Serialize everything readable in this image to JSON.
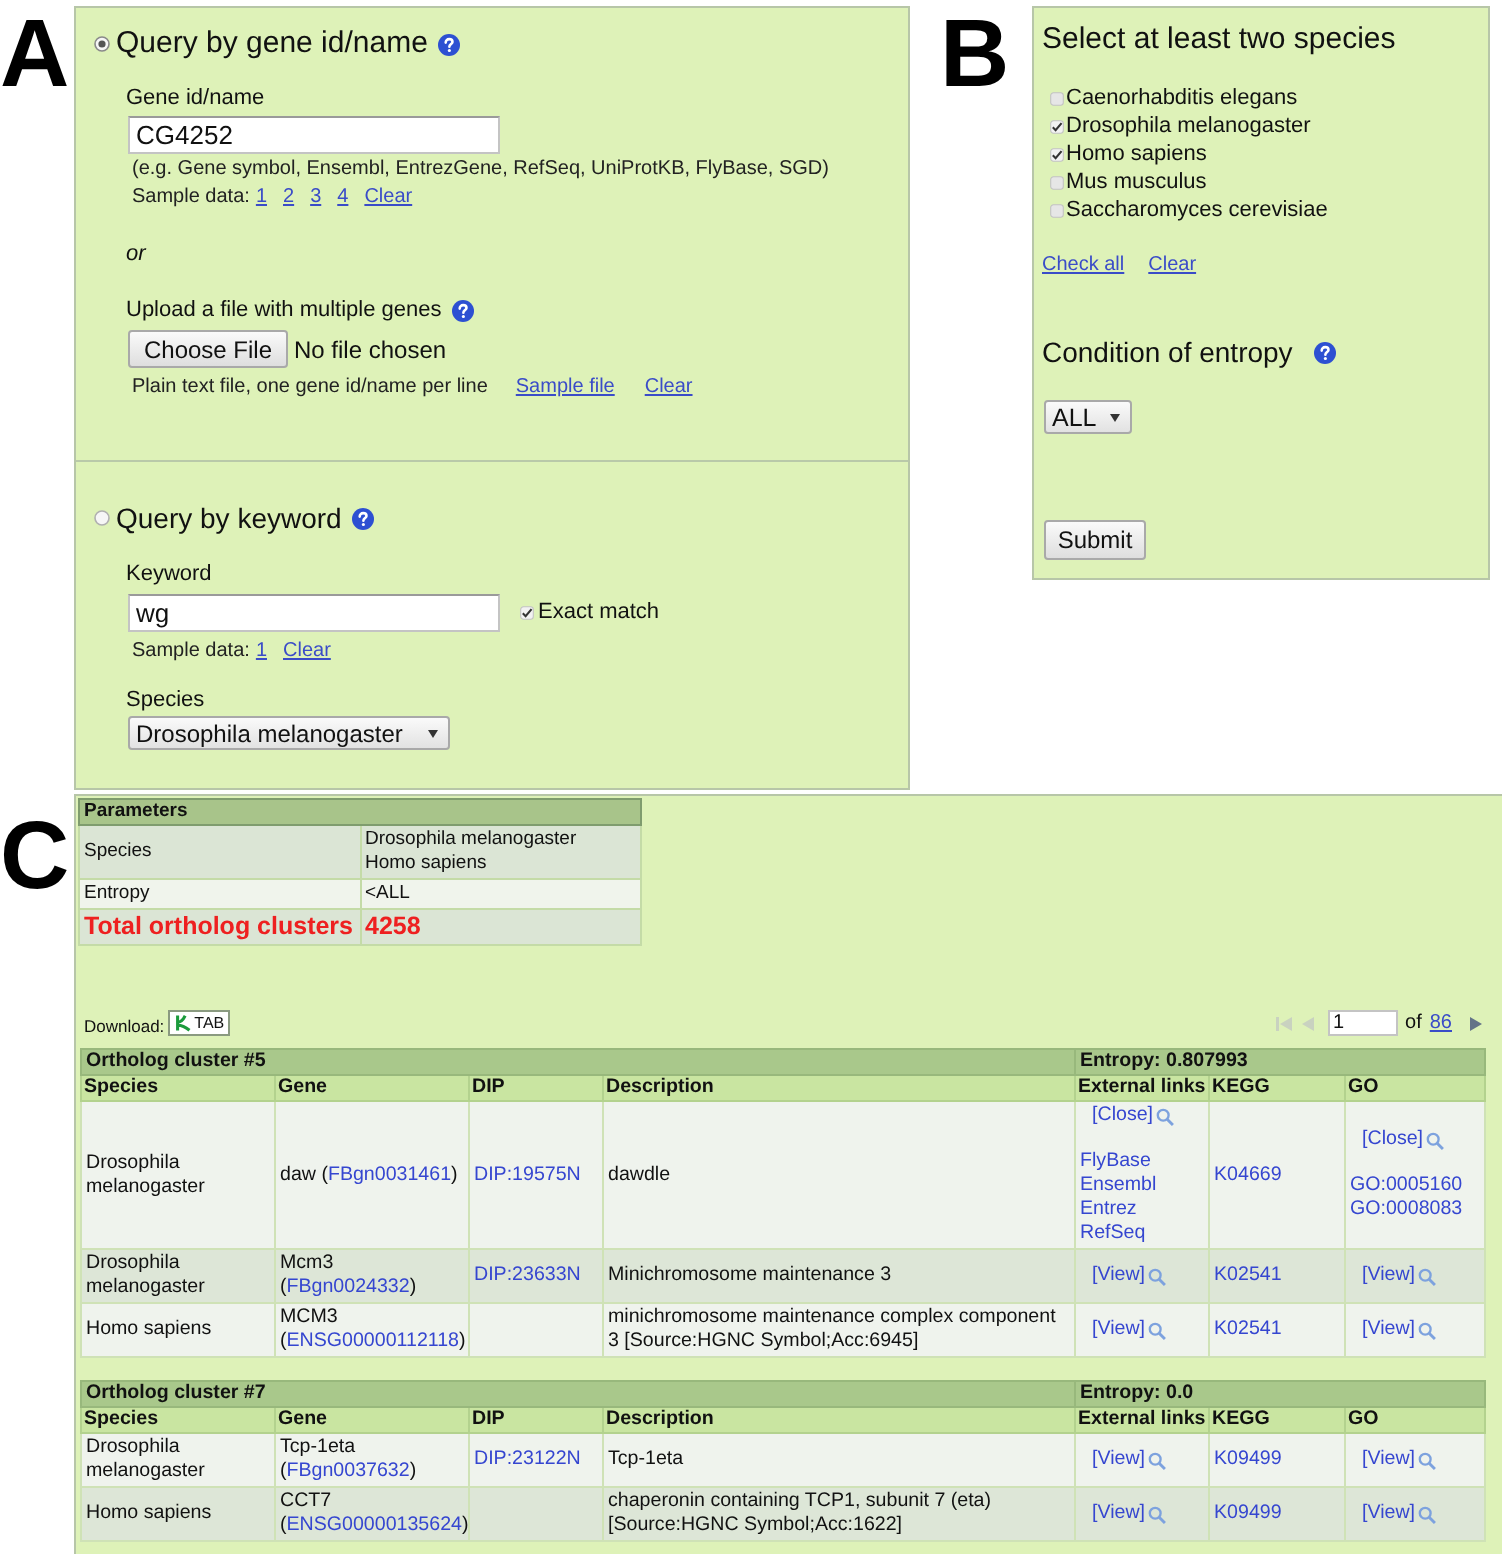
{
  "panel_a": {
    "label": "A",
    "gene_query": {
      "title": "Query by gene id/name",
      "selected": true,
      "field_label": "Gene id/name",
      "value": "CG4252",
      "hint": "(e.g. Gene symbol, Ensembl, EntrezGene, RefSeq, UniProtKB, FlyBase, SGD)",
      "sample_label": "Sample data:",
      "sample_links": [
        "1",
        "2",
        "3",
        "4"
      ],
      "clear_link": "Clear",
      "separator": "or",
      "upload_label": "Upload a file with multiple genes",
      "file_button": "Choose File",
      "file_status": "No file chosen",
      "upload_hint": "Plain text file, one gene id/name per line",
      "sample_file_link": "Sample file",
      "upload_clear_link": "Clear"
    },
    "keyword_query": {
      "title": "Query by keyword",
      "selected": false,
      "field_label": "Keyword",
      "value": "wg",
      "exact_match": {
        "label": "Exact match",
        "checked": true
      },
      "sample_label": "Sample data:",
      "sample_links": [
        "1"
      ],
      "clear_link": "Clear",
      "species_label": "Species",
      "species_value": "Drosophila melanogaster"
    }
  },
  "panel_b": {
    "label": "B",
    "title": "Select at least two species",
    "species": [
      {
        "name": "Caenorhabditis elegans",
        "checked": false
      },
      {
        "name": "Drosophila melanogaster",
        "checked": true
      },
      {
        "name": "Homo sapiens",
        "checked": true
      },
      {
        "name": "Mus musculus",
        "checked": false
      },
      {
        "name": "Saccharomyces cerevisiae",
        "checked": false
      }
    ],
    "check_all_link": "Check all",
    "clear_link": "Clear",
    "entropy_title": "Condition of entropy",
    "entropy_value": "ALL",
    "submit": "Submit"
  },
  "panel_c": {
    "label": "C",
    "parameters": {
      "title": "Parameters",
      "rows": [
        {
          "kind": "parameter",
          "name": "Species",
          "values": [
            "Drosophila melanogaster",
            "Homo sapiens"
          ]
        },
        {
          "kind": "parameter",
          "name": "Entropy",
          "values": [
            "<ALL"
          ]
        },
        {
          "kind": "total",
          "name": "Total ortholog clusters",
          "values": [
            "4258"
          ]
        }
      ]
    },
    "download": {
      "label": "Download:",
      "button": "TAB"
    },
    "pager": {
      "back_buttons": [
        {
          "kind": "first",
          "disabled": true
        },
        {
          "kind": "previous",
          "disabled": true
        }
      ],
      "page": "1",
      "of_label": "of",
      "total_link": "86",
      "forward_buttons": [
        {
          "kind": "next",
          "disabled": false
        }
      ]
    },
    "clusters": [
      {
        "title": "Ortholog cluster #5",
        "entropy": "Entropy: 0.807993",
        "columns": [
          "Species",
          "Gene",
          "DIP",
          "Description",
          "External links",
          "KEGG",
          "GO"
        ],
        "rows": [
          {
            "species": "Drosophila melanogaster",
            "gene": {
              "prefix": "daw (",
              "id": "FBgn0031461",
              "suffix": ")"
            },
            "dip": "DIP:19575N",
            "description": "dawdle",
            "external_links": {
              "toggle": "[Close]",
              "links": [
                "FlyBase",
                "Ensembl",
                "Entrez",
                "RefSeq"
              ]
            },
            "kegg": "K04669",
            "go": {
              "toggle": "[Close]",
              "links": [
                "GO:0005160",
                "GO:0008083"
              ]
            }
          },
          {
            "species": "Drosophila melanogaster",
            "gene": {
              "prefix": "Mcm3 (",
              "id": "FBgn0024332",
              "suffix": ")"
            },
            "dip": "DIP:23633N",
            "description": "Minichromosome maintenance 3",
            "external_links": {
              "toggle": "[View]"
            },
            "kegg": "K02541",
            "go": {
              "toggle": "[View]"
            }
          },
          {
            "species": "Homo sapiens",
            "gene": {
              "prefix": "MCM3 (",
              "id": "ENSG00000112118",
              "suffix": ")"
            },
            "description": "minichromosome maintenance complex component 3 [Source:HGNC Symbol;Acc:6945]",
            "external_links": {
              "toggle": "[View]"
            },
            "kegg": "K02541",
            "go": {
              "toggle": "[View]"
            }
          }
        ]
      },
      {
        "title": "Ortholog cluster #7",
        "entropy": "Entropy: 0.0",
        "columns": [
          "Species",
          "Gene",
          "DIP",
          "Description",
          "External links",
          "KEGG",
          "GO"
        ],
        "rows": [
          {
            "species": "Drosophila melanogaster",
            "gene": {
              "prefix": "Tcp-1eta (",
              "id": "FBgn0037632",
              "suffix": ")"
            },
            "dip": "DIP:23122N",
            "description": "Tcp-1eta",
            "external_links": {
              "toggle": "[View]"
            },
            "kegg": "K09499",
            "go": {
              "toggle": "[View]"
            }
          },
          {
            "species": "Homo sapiens",
            "gene": {
              "prefix": "CCT7 (",
              "id": "ENSG00000135624",
              "suffix": ")"
            },
            "description": "chaperonin containing TCP1, subunit 7 (eta) [Source:HGNC Symbol;Acc:1622]",
            "external_links": {
              "toggle": "[View]"
            },
            "kegg": "K09499",
            "go": {
              "toggle": "[View]"
            }
          }
        ]
      }
    ]
  }
}
